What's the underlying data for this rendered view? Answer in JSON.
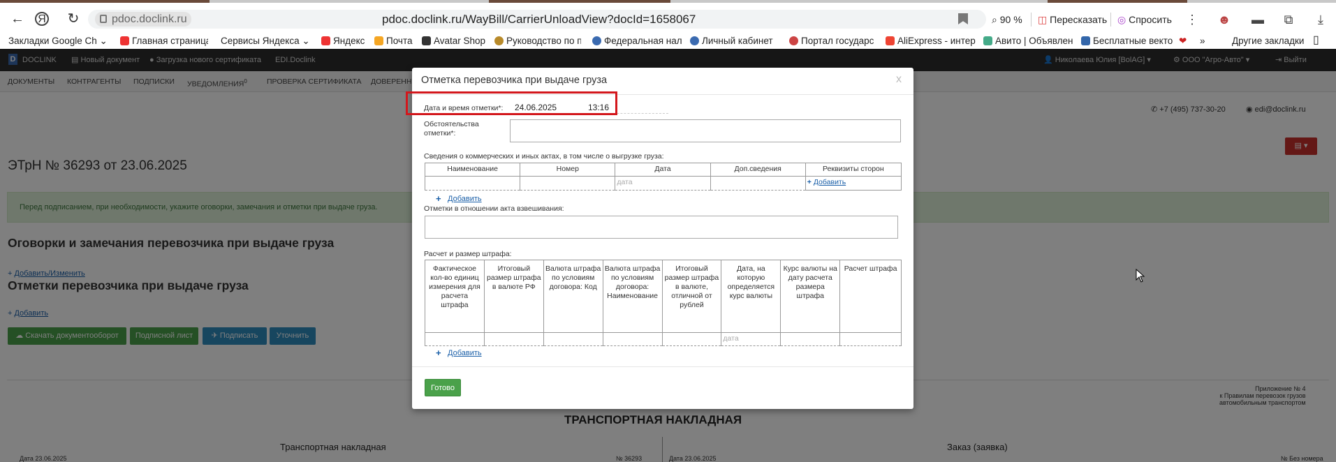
{
  "browser": {
    "url_domain": "pdoc.doclink.ru",
    "url": "pdoc.doclink.ru/WayBill/CarrierUnloadView?docId=1658067",
    "zoom": "90 %",
    "retell": "Пересказать",
    "ask": "Спросить"
  },
  "bookmarks": [
    "Закладки Google Ch",
    "Главная страница",
    "Сервисы Яндекса",
    "Яндекс",
    "Почта",
    "Avatar Shop",
    "Руководство по п",
    "Федеральная нал",
    "Личный кабинет",
    "Портал государс",
    "AliExpress - интер",
    "Авито | Объявлен",
    "Бесплатные векто"
  ],
  "bookmarks_more": "»",
  "bookmarks_other": "Другие закладки",
  "app": {
    "logo": "DOCLINK",
    "new_doc": "Новый документ",
    "cert_upload": "Загрузка нового сертификата",
    "edi": "EDI.Doclink",
    "user": "Николаева Юлия [BolAG]",
    "org": "ООО \"Агро-Авто\"",
    "logout": "Выйти",
    "menu": [
      "ДОКУМЕНТЫ",
      "КОНТРАГЕНТЫ",
      "ПОДПИСКИ",
      "УВЕДОМЛЕНИЯ",
      "ПРОВЕРКА СЕРТИФИКАТА",
      "ДОВЕРЕННО"
    ],
    "notif_count": "0",
    "phone": "+7 (495) 737-30-20",
    "email": "edi@doclink.ru",
    "doc_title": "ЭТрН №  36293  от  23.06.2025",
    "info_text": "Перед подписанием, при необходимости, укажите оговорки, замечания и отметки при выдаче груза.",
    "section1": "Оговорки и замечания перевозчика при выдаче груза",
    "section1_link": "Добавить/Изменить",
    "section2": "Отметки перевозчика при выдаче груза",
    "section2_link": "Добавить",
    "btn_download": "Скачать документооборот",
    "btn_sigsheet": "Подписной лист",
    "btn_sign": "Подписать",
    "btn_clarify": "Уточнить",
    "annex": [
      "Приложение № 4",
      "к Правилам перевозок грузов",
      "автомобильным транспортом"
    ],
    "doc_big_title": "ТРАНСПОРТНАЯ НАКЛАДНАЯ",
    "col_left_title": "Транспортная накладная",
    "col_right_title": "Заказ (заявка)",
    "left_date": "Дата 23.06.2025",
    "left_num": "№  36293",
    "right_date": "Дата 23.06.2025",
    "right_num": "№ Без номера"
  },
  "modal": {
    "title": "Отметка перевозчика при выдаче груза",
    "close": "x",
    "datetime_label": "Дата и время отметки*:",
    "date_value": "24.06.2025",
    "time_value": "13:16",
    "circumstances_label": "Обстоятельства отметки*:",
    "acts_label": "Сведения о коммерческих и иных актах, в том числе о выгрузке груза:",
    "acts_headers": [
      "Наименование",
      "Номер",
      "Дата",
      "Доп.сведения",
      "Реквизиты сторон"
    ],
    "date_placeholder": "дата",
    "add": "Добавить",
    "weigh_label": "Отметки в отношении акта взвешивания:",
    "fine_label": "Расчет и размер штрафа:",
    "fine_headers": [
      "Фактическое кол-во единиц измерения для расчета штрафа",
      "Итоговый размер штрафа в валюте РФ",
      "Валюта штрафа по условиям договора: Код",
      "Валюта штрафа по условиям договора: Наименование",
      "Итоговый размер штрафа в валюте, отличной от рублей",
      "Дата, на которую определяется курс валюты",
      "Курс валюты на дату расчета размера штрафа",
      "Расчет штрафа"
    ],
    "done": "Готово"
  }
}
